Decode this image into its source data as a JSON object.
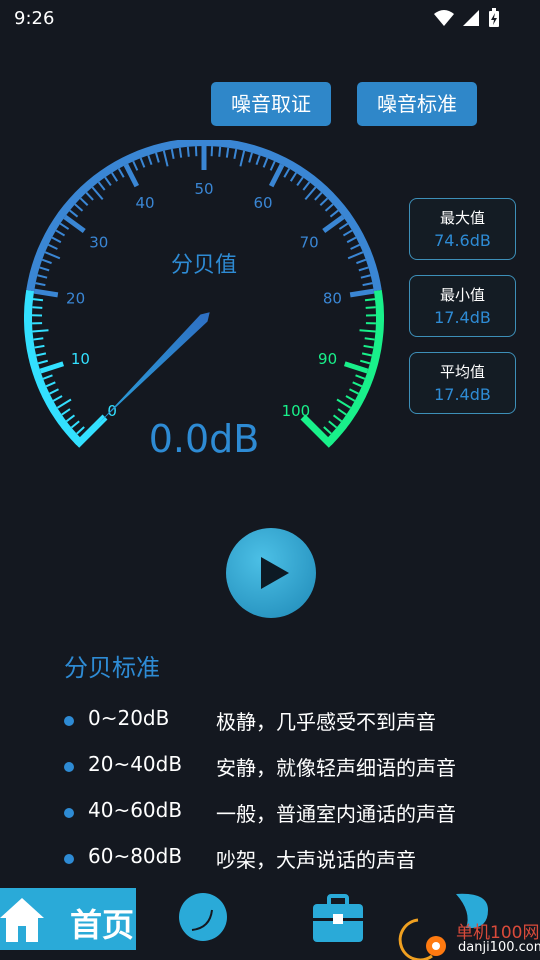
{
  "status": {
    "time": "9:26"
  },
  "header": {
    "forensics_label": "噪音取证",
    "standard_label": "噪音标准"
  },
  "gauge": {
    "title": "分贝值",
    "reading": "0.0dB",
    "min": 0,
    "max": 100,
    "value": 0,
    "ticks": [
      "0",
      "10",
      "20",
      "30",
      "40",
      "50",
      "60",
      "70",
      "80",
      "90",
      "100"
    ],
    "colors": {
      "blue": "#3a86d4",
      "cyan": "#33e0ff",
      "green": "#19f08a",
      "label": "#2e8bd4"
    }
  },
  "stats": [
    {
      "label": "最大值",
      "value": "74.6dB"
    },
    {
      "label": "最小值",
      "value": "17.4dB"
    },
    {
      "label": "平均值",
      "value": "17.4dB"
    }
  ],
  "standards": {
    "title": "分贝标准",
    "items": [
      {
        "range": "0~20dB",
        "desc": "极静，几乎感受不到声音"
      },
      {
        "range": "20~40dB",
        "desc": "安静，就像轻声细语的声音"
      },
      {
        "range": "40~60dB",
        "desc": "一般，普通室内通话的声音"
      },
      {
        "range": "60~80dB",
        "desc": "吵架，大声说话的声音"
      }
    ]
  },
  "nav": {
    "home_label": "首页",
    "items": [
      "home-icon",
      "meter-icon",
      "toolbox-icon",
      "profile-icon"
    ]
  },
  "watermark": {
    "brand": "单机100网",
    "url": "danji100.com"
  }
}
